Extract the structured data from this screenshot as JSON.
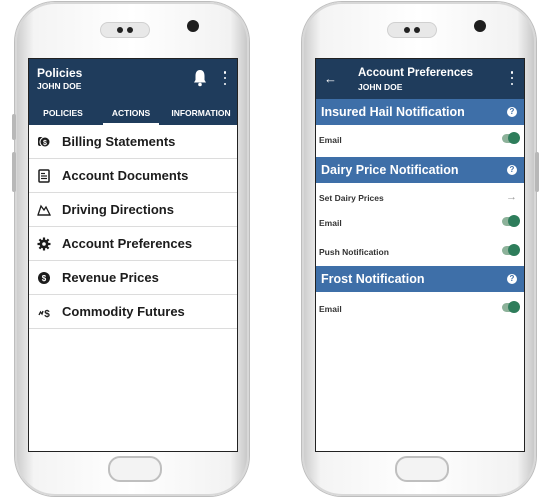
{
  "left_phone": {
    "header": {
      "title": "Policies",
      "user": "JOHN DOE"
    },
    "tabs": [
      {
        "label": "POLICIES"
      },
      {
        "label": "ACTIONS",
        "active": true
      },
      {
        "label": "INFORMATION"
      }
    ],
    "menu_items": [
      {
        "label": "Billing Statements",
        "icon": "dollar-coin-icon"
      },
      {
        "label": "Account Documents",
        "icon": "document-icon"
      },
      {
        "label": "Driving Directions",
        "icon": "map-icon"
      },
      {
        "label": "Account Preferences",
        "icon": "gear-icon"
      },
      {
        "label": "Revenue Prices",
        "icon": "coin-icon"
      },
      {
        "label": "Commodity Futures",
        "icon": "dollar-sign-icon"
      }
    ]
  },
  "right_phone": {
    "header": {
      "title": "Account Preferences",
      "user": "JOHN DOE",
      "back_icon": "←"
    },
    "sections": [
      {
        "title": "Insured Hail Notification",
        "rows": [
          {
            "label": "Email",
            "control": "toggle",
            "on": true
          }
        ]
      },
      {
        "title": "Dairy Price Notification",
        "rows": [
          {
            "label": "Set Dairy Prices",
            "control": "arrow",
            "arrow": "→"
          },
          {
            "label": "Email",
            "control": "toggle",
            "on": true
          },
          {
            "label": "Push Notification",
            "control": "toggle",
            "on": true
          }
        ]
      },
      {
        "title": "Frost Notification",
        "rows": [
          {
            "label": "Email",
            "control": "toggle",
            "on": true
          }
        ]
      }
    ],
    "help_glyph": "?"
  },
  "colors": {
    "header_bg": "#1f3c5c",
    "section_bg": "#3e6fa8",
    "toggle_on": "#2e7d5b"
  }
}
